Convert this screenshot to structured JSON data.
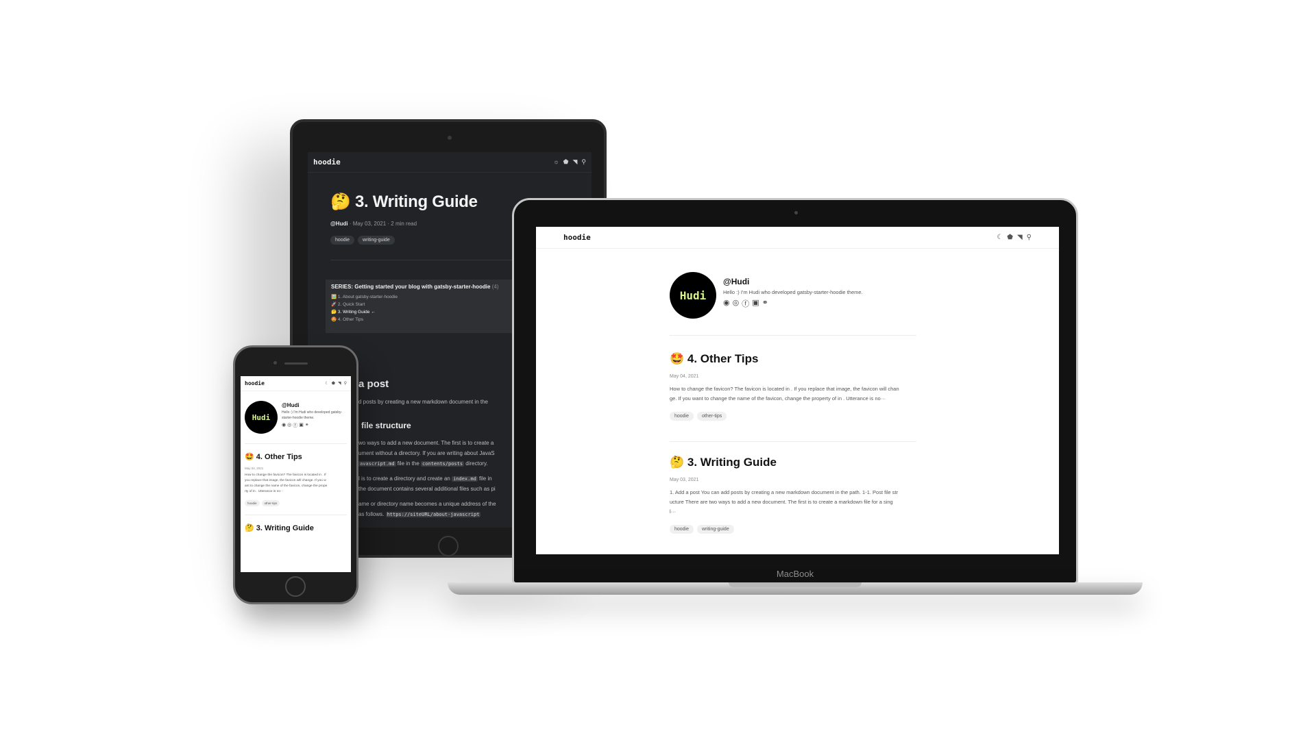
{
  "tablet": {
    "logo": "hoodie",
    "header_icons": [
      "sun-icon",
      "tag-icon",
      "rss-icon",
      "search-icon"
    ],
    "post_title": "🤔 3. Writing Guide",
    "author": "@Hudi",
    "meta": " · May 03, 2021 · 2 min read",
    "tags": [
      "hoodie",
      "writing-guide"
    ],
    "series": {
      "title": "SERIES: Getting started your blog with gatsby-starter-hoodie",
      "count": "(4)",
      "items": [
        "🖼️ 1. About gatsby-starter-hoodie",
        "🚀 2. Quick Start",
        "🤔 3. Writing Guide ←",
        "🤩 4. Other Tips"
      ]
    },
    "h2": "a post",
    "p1": "d posts by creating a new markdown document in the",
    "h3": "file structure",
    "p2": "wo ways to add a new document. The first is to create a",
    "p3": "ument without a directory. If you are writing about JavaS",
    "p4_code": "avascript.md",
    "p4_mid": " file in the ",
    "p4_code2": "contents/posts",
    "p4_end": " directory.",
    "p5_start": "l is to create a directory and create an ",
    "p5_code": "index.md",
    "p5_end": " file in",
    "p6": "the document contains several additional files such as pi",
    "p7": "ame or directory name becomes a unique address of the",
    "p8_start": " as follows. ",
    "p8_code": "https://siteURL/about-javascript"
  },
  "laptop": {
    "logo": "hoodie",
    "brand": "MacBook",
    "header_icons": [
      "moon-icon",
      "tag-icon",
      "rss-icon",
      "search-icon"
    ],
    "bio": {
      "avatar_text": "Hudi",
      "name": "@Hudi",
      "description": "Hello :) I'm Hudi who developed gatsby-starter-hoodie theme."
    },
    "posts": [
      {
        "title": "🤩 4. Other Tips",
        "date": "May 04, 2021",
        "excerpt_1": "How to change the favicon? The favicon is located in . If you replace that image, the favicon will chan",
        "excerpt_2": "ge. If you want to change the name of the favicon, change the property of in . Utterance is no···",
        "excerpt_3": "",
        "tags": [
          "hoodie",
          "other-tips"
        ]
      },
      {
        "title": "🤔 3. Writing Guide",
        "date": "May 03, 2021",
        "excerpt_1": "1. Add a post You can add posts by creating a new markdown document in the path. 1-1. Post file str",
        "excerpt_2": "ucture There are two ways to add a new document. The first is to create a markdown file for a sing",
        "excerpt_3": "l···",
        "tags": [
          "hoodie",
          "writing-guide"
        ]
      }
    ]
  },
  "phone": {
    "logo": "hoodie",
    "header_icons": [
      "moon-icon",
      "tag-icon",
      "rss-icon",
      "search-icon"
    ],
    "bio": {
      "avatar_text": "Hudi",
      "name": "@Hudi",
      "description": "Hello :) I'm Hudi who developed gatsby-starter-hoodie theme."
    },
    "post": {
      "title": "🤩 4. Other Tips",
      "date": "May 04, 2021",
      "excerpt_1": "How to change the favicon? The favicon is located in . If",
      "excerpt_2": "you replace that image, the favicon will change. If you w",
      "excerpt_3": "ant to change the name of the favicon, change the prope",
      "excerpt_4": "rty of in . Utterance is no···",
      "tags": [
        "hoodie",
        "other-tips"
      ]
    },
    "next_title": "🤔 3. Writing Guide"
  }
}
